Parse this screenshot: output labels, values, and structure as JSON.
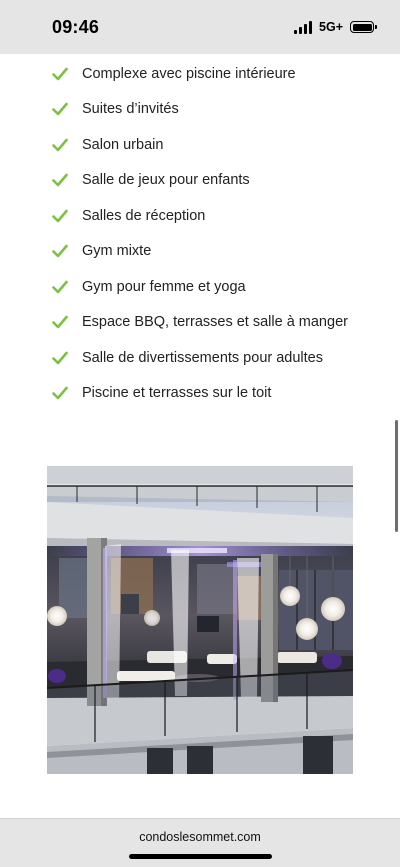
{
  "status_bar": {
    "time": "09:46",
    "network": "5G+",
    "battery_level": 1.0
  },
  "amenities": {
    "check_color": "#7cc142",
    "items": [
      {
        "label": "Complexe avec piscine intérieure",
        "icon": "check-icon"
      },
      {
        "label": "Suites d’invités",
        "icon": "check-icon"
      },
      {
        "label": "Salon urbain",
        "icon": "check-icon"
      },
      {
        "label": "Salle de jeux pour enfants",
        "icon": "check-icon"
      },
      {
        "label": "Salles de réception",
        "icon": "check-icon"
      },
      {
        "label": "Gym mixte",
        "icon": "check-icon"
      },
      {
        "label": "Gym pour femme et yoga",
        "icon": "check-icon"
      },
      {
        "label": "Espace BBQ, terrasses et salle à manger",
        "icon": "check-icon"
      },
      {
        "label": "Salle de divertissements pour adultes",
        "icon": "check-icon"
      },
      {
        "label": "Piscine et terrasses sur le toit",
        "icon": "check-icon"
      }
    ]
  },
  "browser": {
    "url": "condoslesommet.com"
  }
}
